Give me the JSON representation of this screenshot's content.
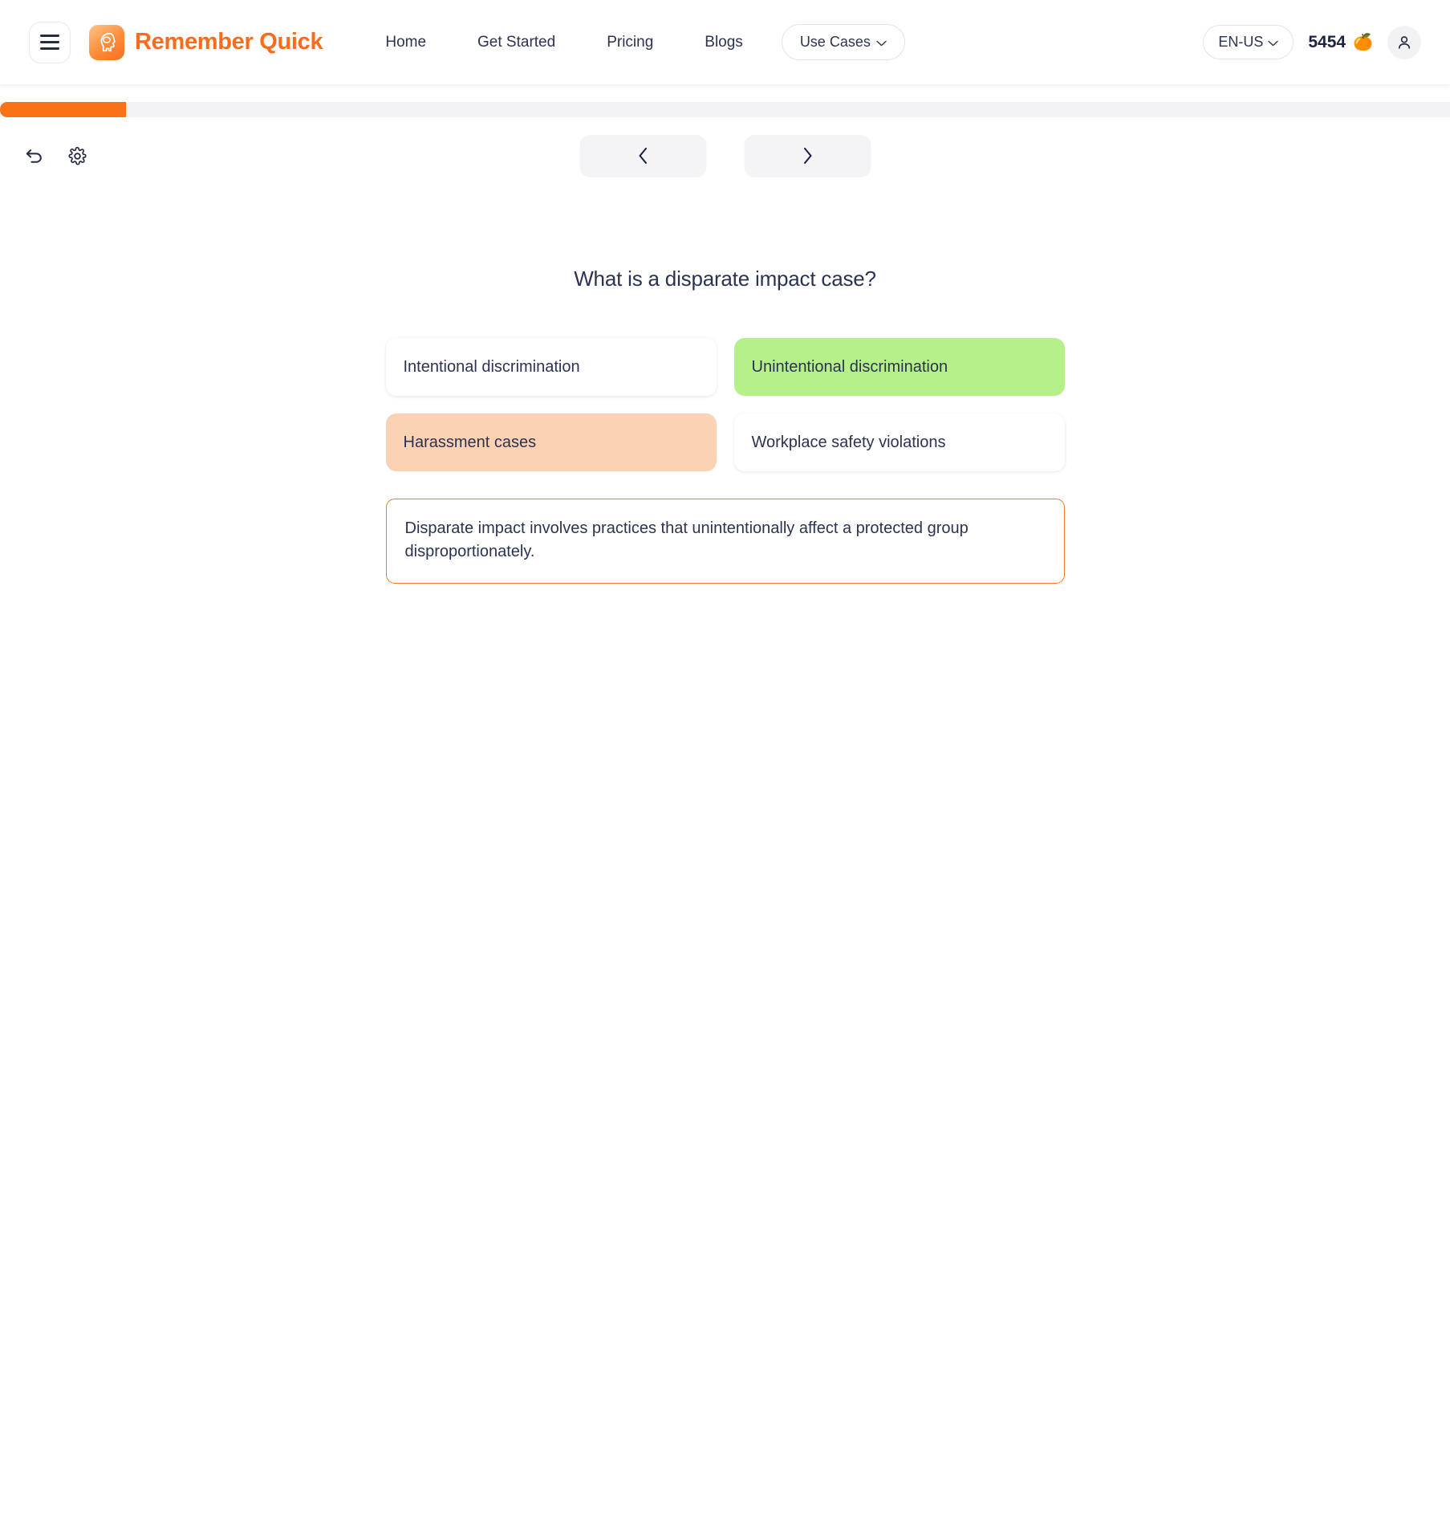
{
  "header": {
    "menu_button": "menu",
    "brand_name": "Remember Quick",
    "brand_logo_icon": "brain-head-icon",
    "nav_links": [
      {
        "label": "Home"
      },
      {
        "label": "Get Started"
      },
      {
        "label": "Pricing"
      },
      {
        "label": "Blogs"
      }
    ],
    "use_cases": {
      "label": "Use Cases",
      "chevron": "⌄"
    },
    "language": {
      "label": "EN-US",
      "chevron": "⌄"
    },
    "credits": {
      "value": "5454",
      "emoji": "🍊"
    },
    "avatar_icon": "person-icon"
  },
  "progress": {
    "percent": 8.7,
    "fill_color": "#f97316",
    "track_color": "#f3f3f5"
  },
  "toolbar": {
    "undo_icon": "undo-arrow-icon",
    "settings_icon": "gear-icon",
    "prev_label": "‹",
    "next_label": "›"
  },
  "quiz": {
    "question": "What is a disparate impact case?",
    "options": [
      {
        "label": "Intentional discrimination",
        "state": "default"
      },
      {
        "label": "Unintentional discrimination",
        "state": "correct"
      },
      {
        "label": "Harassment cases",
        "state": "selected-wrong"
      },
      {
        "label": "Workplace safety violations",
        "state": "default"
      }
    ],
    "explanation": "Disparate impact involves practices that unintentionally affect a protected group disproportionately."
  },
  "colors": {
    "brand_orange": "#fa6c1c",
    "correct_green": "#b5f08a",
    "wrong_peach": "#fbd3b4",
    "explanation_border": "#f07c26",
    "text_navy": "#2b3350"
  }
}
